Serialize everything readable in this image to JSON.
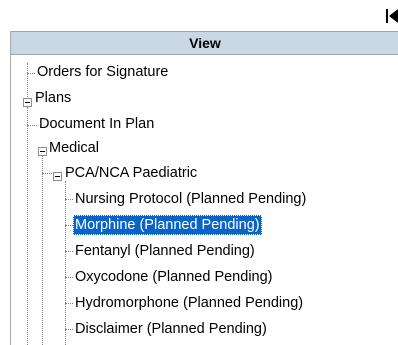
{
  "panel": {
    "header": "View"
  },
  "tree": {
    "orders_for_signature": "Orders for Signature",
    "plans": "Plans",
    "document_in_plan": "Document In Plan",
    "medical": "Medical",
    "pca_nca": "PCA/NCA Paediatric",
    "items": [
      "Nursing Protocol (Planned Pending)",
      "Morphine (Planned Pending)",
      "Fentanyl (Planned Pending)",
      "Oxycodone (Planned Pending)",
      "Hydromorphone (Planned Pending)",
      "Disclaimer (Planned Pending)"
    ],
    "selected_item": "Morphine (Planned Pending)"
  },
  "icons": {
    "collapse_panel": "collapse-left-icon",
    "node_expanded": "minus-box-icon"
  },
  "colors": {
    "header_bg": "#c9d6e4",
    "selection_bg": "#0a64c8"
  }
}
